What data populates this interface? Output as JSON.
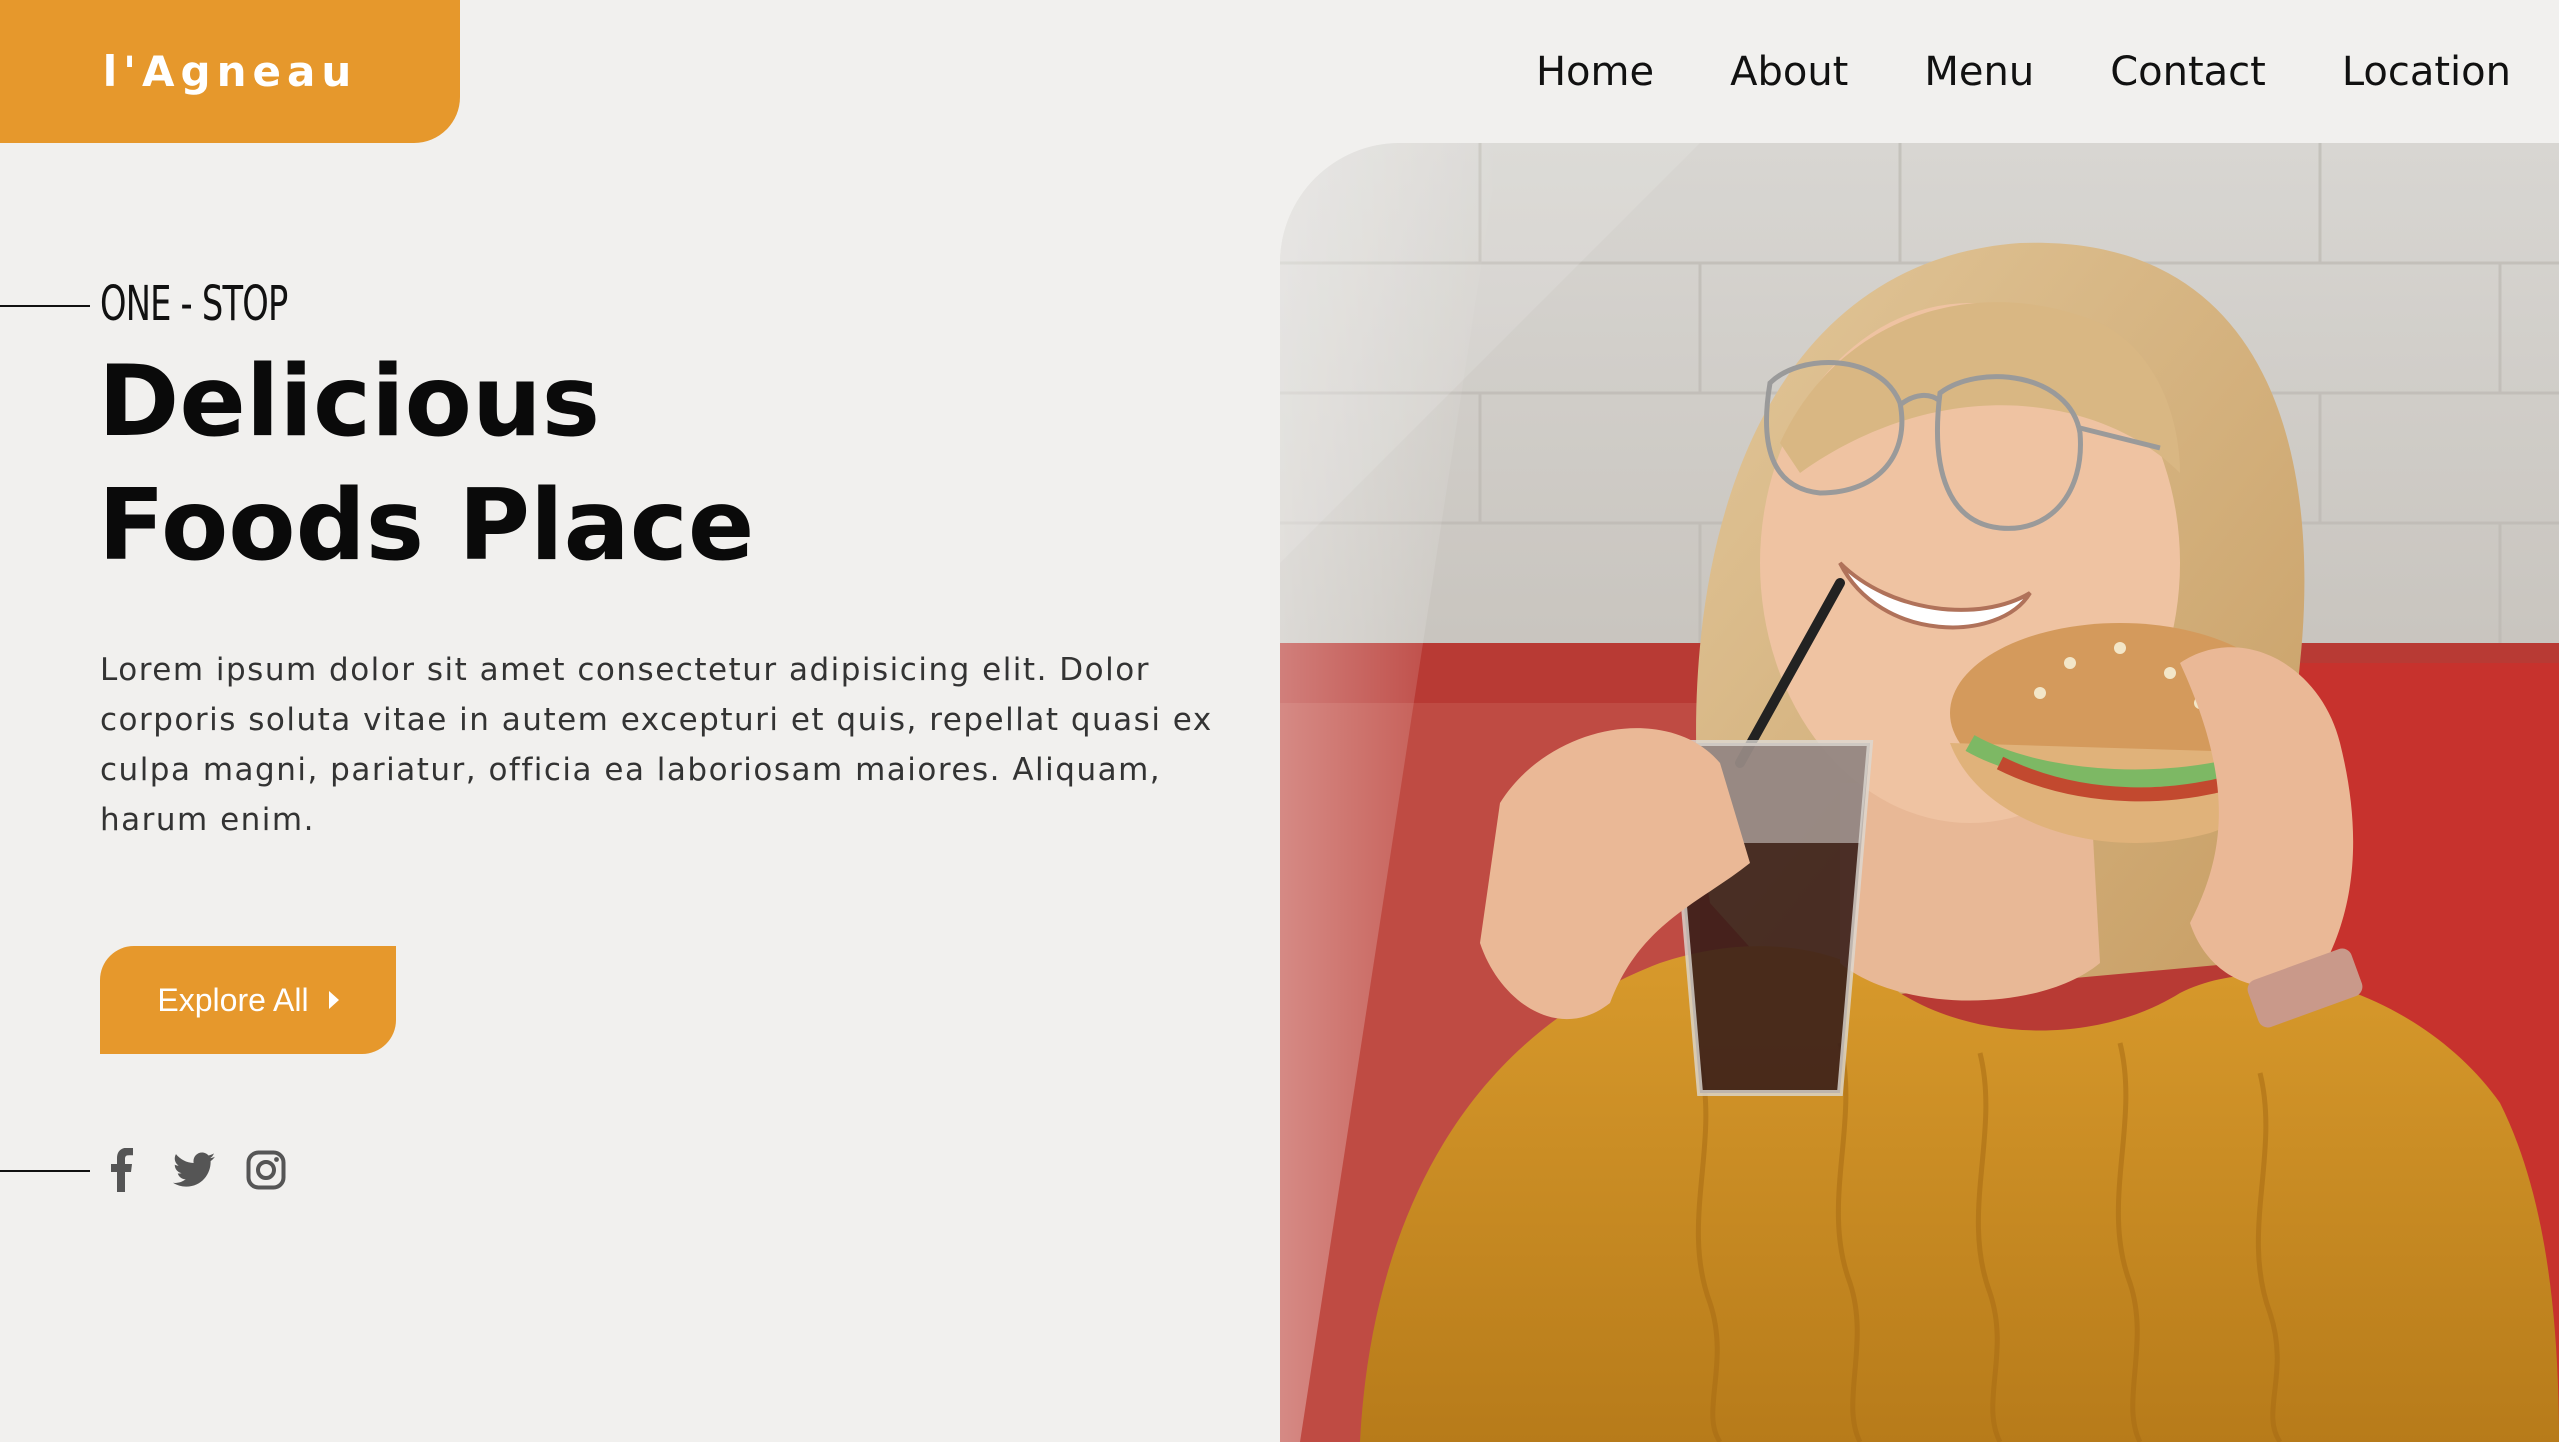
{
  "brand": {
    "name": "l'Agneau",
    "accent_color": "#e6982c"
  },
  "nav": {
    "items": [
      {
        "label": "Home"
      },
      {
        "label": "About"
      },
      {
        "label": "Menu"
      },
      {
        "label": "Contact"
      },
      {
        "label": "Location"
      }
    ]
  },
  "hero": {
    "eyebrow": "ONE - STOP",
    "headline_line1": "Delicious",
    "headline_line2": "Foods Place",
    "body": "Lorem ipsum dolor sit amet consectetur adipisicing elit. Dolor corporis soluta vitae in autem excepturi et quis, repellat quasi ex culpa magni, pariatur, officia ea laboriosam maiores. Aliquam, harum enim.",
    "cta_label": "Explore All",
    "cta_icon": "caret-right-icon"
  },
  "social": {
    "icons": [
      "facebook-icon",
      "twitter-icon",
      "instagram-icon"
    ]
  },
  "image": {
    "subject": "woman-eating-burger-photo"
  }
}
